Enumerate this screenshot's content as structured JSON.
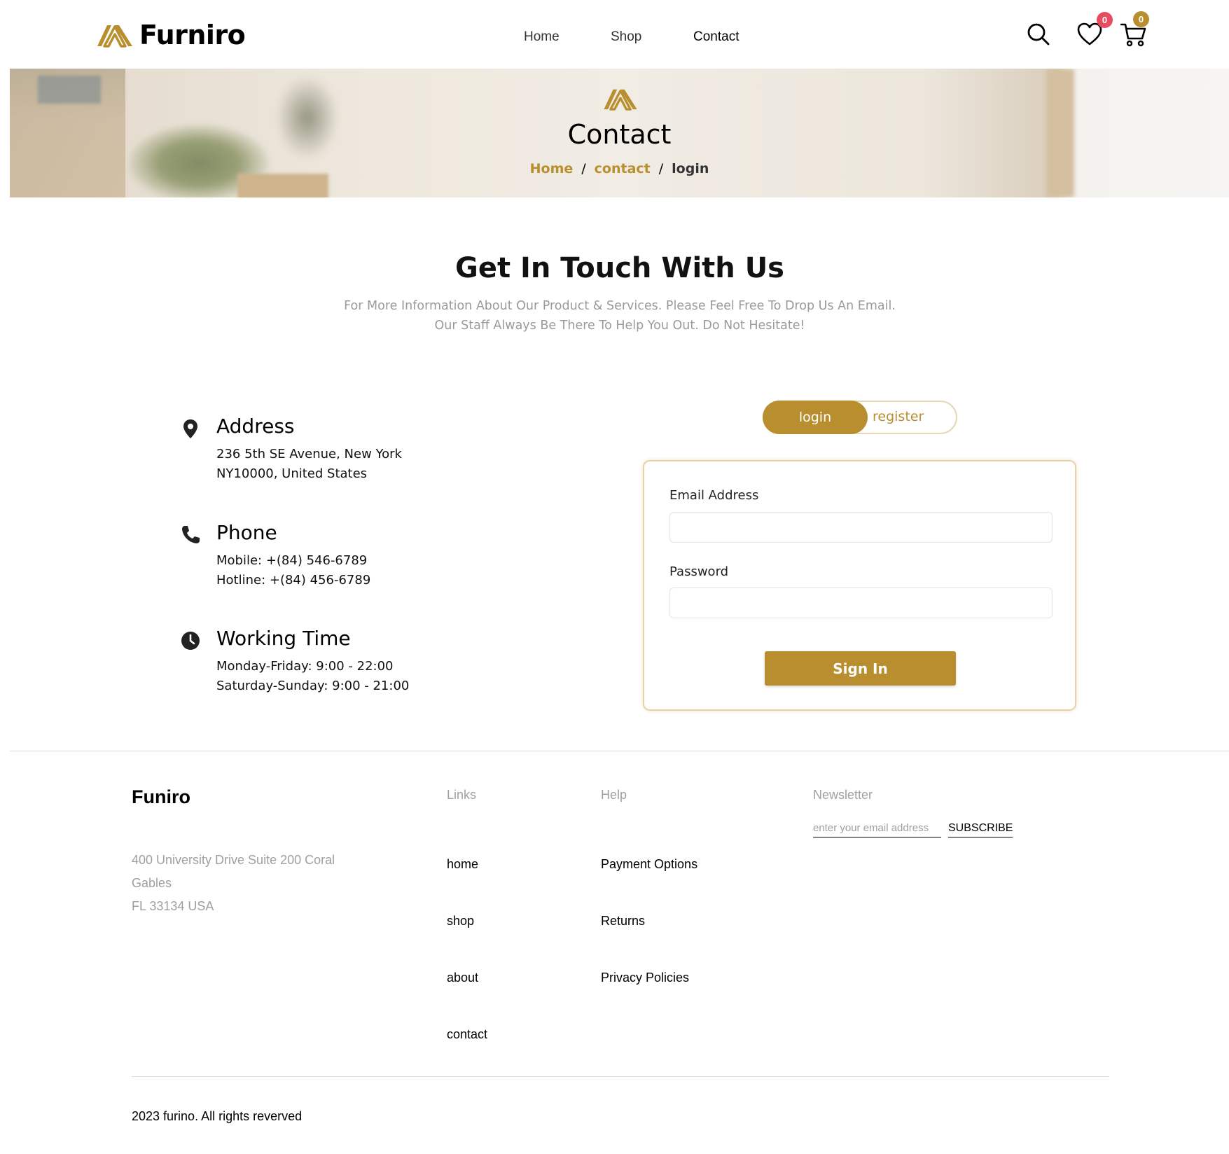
{
  "header": {
    "brand": "Furniro",
    "nav": [
      {
        "label": "Home"
      },
      {
        "label": "Shop"
      },
      {
        "label": "Contact"
      }
    ],
    "wishlist_count": "0",
    "cart_count": "0",
    "icons": {
      "search": "search-icon",
      "wishlist": "heart-icon",
      "cart": "cart-icon"
    }
  },
  "hero": {
    "title": "Contact",
    "breadcrumb": [
      {
        "label": "Home"
      },
      {
        "label": "contact"
      },
      {
        "label": "login"
      }
    ],
    "separator": "/"
  },
  "intro": {
    "title": "Get In Touch With Us",
    "text": "For More Information About Our Product & Services. Please Feel Free To Drop Us An Email. Our Staff Always Be There To Help You Out. Do Not Hesitate!"
  },
  "contact_info": [
    {
      "icon": "location-pin-icon",
      "title": "Address",
      "lines": [
        "236 5th SE Avenue, New York",
        "NY10000, United States"
      ]
    },
    {
      "icon": "phone-icon",
      "title": "Phone",
      "lines": [
        "Mobile: +(84) 546-6789",
        "Hotline: +(84) 456-6789"
      ]
    },
    {
      "icon": "clock-icon",
      "title": "Working Time",
      "lines": [
        "Monday-Friday: 9:00 - 22:00",
        "Saturday-Sunday: 9:00 - 21:00"
      ]
    }
  ],
  "auth": {
    "tabs": {
      "login": "login",
      "register": "register"
    },
    "active_tab": "login",
    "email_label": "Email Address",
    "email_value": "",
    "password_label": "Password",
    "password_value": "",
    "submit_label": "Sign In"
  },
  "footer": {
    "brand": "Funiro",
    "address_lines": [
      "400 University Drive Suite 200 Coral",
      "Gables",
      "FL 33134 USA"
    ],
    "links_heading": "Links",
    "links": [
      "home",
      "shop",
      "about",
      "contact"
    ],
    "help_heading": "Help",
    "help": [
      "Payment Options",
      "Returns",
      "Privacy Policies"
    ],
    "newsletter_heading": "Newsletter",
    "newsletter_placeholder": "enter your email address",
    "subscribe_label": "SUBSCRIBE",
    "copyright": "2023 furino. All rights reverved"
  },
  "colors": {
    "accent": "#b88e2f",
    "wishlist_badge": "#e84b5f",
    "muted": "#9f9f9f"
  }
}
